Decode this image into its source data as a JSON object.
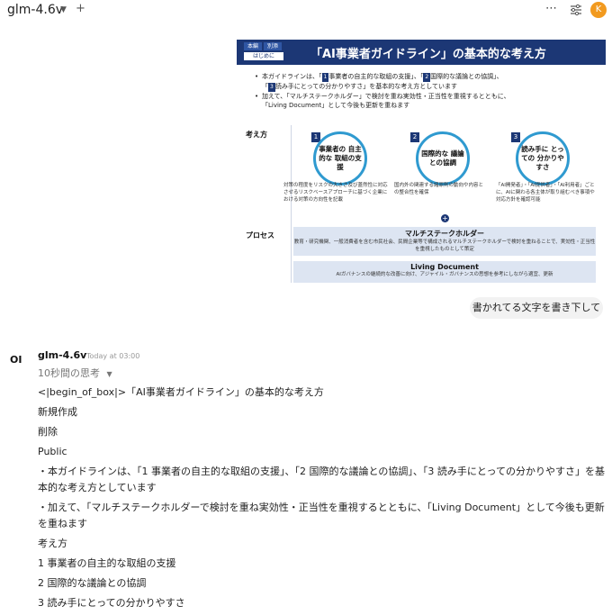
{
  "header": {
    "model_name": "glm-4.6v",
    "user_initial": "K",
    "more_icon": "⋯"
  },
  "slide": {
    "tab1": "本編",
    "tab2": "別添",
    "tab_sub": "はじめに",
    "title": "「AI事業者ガイドライン」の基本的な考え方",
    "bullet1_a": "本ガイドラインは、「",
    "bullet1_num1": "1",
    "bullet1_b": "事業者の自主的な取組の支援」、「",
    "bullet1_num2": "2",
    "bullet1_c": "国際的な議論との協調」、",
    "bullet1_d": "「",
    "bullet1_num3": "3",
    "bullet1_e": "読み手にとっての分かりやすさ」を基本的な考え方としています",
    "bullet2": "加えて、「マルチステークホルダー」で検討を重ね実効性・正当性を重視するとともに、",
    "bullet2_cont": "「Living Document」として今後も更新を重ねます",
    "concept_label": "考え方",
    "process_label": "プロセス",
    "concepts": [
      {
        "num": "1",
        "title": "事業者の 自主的な 取組の支援",
        "desc": "対策の程度をリスクの大きさ及び蓋然性に対応させるリスクベースアプローチに基づく企業における対策の方向性を記載"
      },
      {
        "num": "2",
        "title": "国際的な 議論との協調",
        "desc": "国内外の関連する諸原則の動向や内容との整合性を確保"
      },
      {
        "num": "3",
        "title": "読み手に とっての 分かりやすさ",
        "desc": "「AI開発者」・「AI提供者」・「AI利用者」ごとに、AIに関わる各主体が取り組むべき事項や対応方針を確認可能"
      }
    ],
    "plus_sign": "+",
    "process1_title": "マルチステークホルダー",
    "process1_desc": "教育・研究機関、一般消費者を含む市民社会、民間企業等で構成されるマルチステークホルダーで検討を重ねることで、実効性・正当性を重視したものとして策定",
    "process2_title": "Living Document",
    "process2_desc": "AIガバナンスの継続的な改善に向け、アジャイル・ガバナンスの思想を参考にしながら適宜、更新"
  },
  "user_message": "書かれてる文字を書き下して",
  "reply": {
    "avatar_label": "OI",
    "model_name": "glm-4.6v",
    "timestamp": "Today at 03:00",
    "thinking": "10秒間の思考",
    "line1": "<|begin_of_box|>「AI事業者ガイドライン」の基本的な考え方",
    "line2": "新規作成",
    "line3": "削除",
    "line4": "Public",
    "line5": "・本ガイドラインは、「1 事業者の自主的な取組の支援」、「2 国際的な議論との協調」、「3 読み手にとっての分かりやすさ」を基本的な考え方としています",
    "line6": "・加えて、「マルチステークホルダーで検討を重ね実効性・正当性を重視するとともに、「Living Document」として今後も更新を重ねます",
    "line7": "考え方",
    "line8": "1 事業者の自主的な取組の支援",
    "line9": "2 国際的な議論との協調",
    "line10": "3 読み手にとっての分かりやすさ"
  }
}
